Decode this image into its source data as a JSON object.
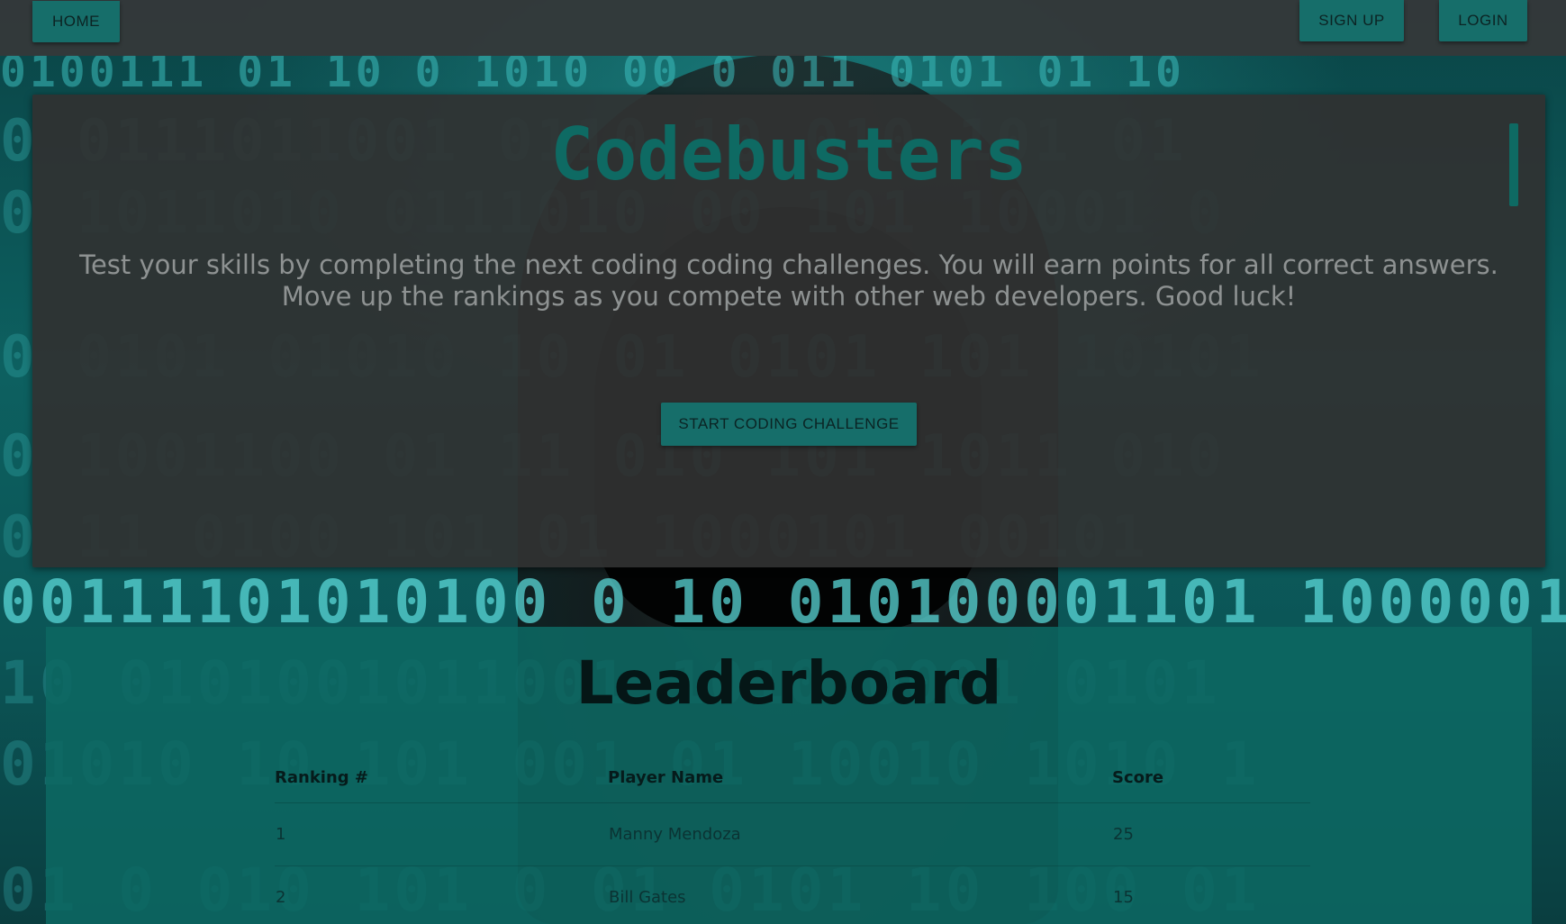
{
  "navbar": {
    "home_label": "HOME",
    "signup_label": "SIGN UP",
    "login_label": "LOGIN"
  },
  "hero": {
    "title": "Codebusters",
    "description": "Test your skills by completing the next coding coding challenges. You will earn points for all correct answers. Move up the rankings as you compete with other web developers. Good luck!",
    "start_button_label": "START CODING CHALLENGE"
  },
  "leaderboard": {
    "title": "Leaderboard",
    "columns": [
      "Ranking #",
      "Player Name",
      "Score"
    ],
    "rows": [
      {
        "rank": "1",
        "name": "Manny Mendoza",
        "score": "25"
      },
      {
        "rank": "2",
        "name": "Bill Gates",
        "score": "15"
      }
    ]
  },
  "colors": {
    "accent": "#166e6a",
    "title_color": "#0e6a63",
    "navbar_bg": "#343839",
    "card_bg": "#303232",
    "leaderboard_bg": "#0d6862"
  }
}
